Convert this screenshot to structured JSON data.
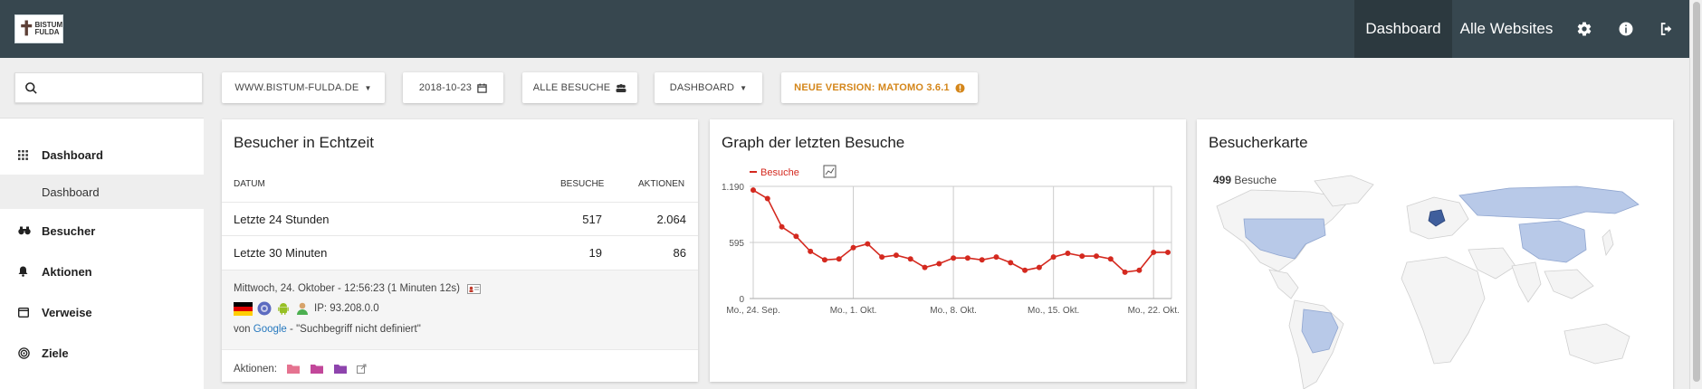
{
  "logo": {
    "line1": "BISTUM",
    "line2": "FULDA"
  },
  "nav": {
    "dashboard": "Dashboard",
    "all_websites": "Alle Websites"
  },
  "toolbar": {
    "search_placeholder": "",
    "site": "WWW.BISTUM-FULDA.DE",
    "date": "2018-10-23",
    "segment": "ALLE BESUCHE",
    "dashboard": "DASHBOARD",
    "version": "NEUE VERSION: MATOMO 3.6.1"
  },
  "sidebar": {
    "items": [
      {
        "label": "Dashboard",
        "icon": "grid-icon"
      },
      {
        "label": "Besucher",
        "icon": "binoculars-icon"
      },
      {
        "label": "Aktionen",
        "icon": "bell-icon"
      },
      {
        "label": "Verweise",
        "icon": "window-icon"
      },
      {
        "label": "Ziele",
        "icon": "target-icon"
      }
    ],
    "sub_item": "Dashboard"
  },
  "realtime": {
    "title": "Besucher in Echtzeit",
    "columns": [
      "DATUM",
      "BESUCHE",
      "AKTIONEN"
    ],
    "rows": [
      {
        "label": "Letzte 24 Stunden",
        "visits": "517",
        "actions": "2.064"
      },
      {
        "label": "Letzte 30 Minuten",
        "visits": "19",
        "actions": "86"
      }
    ],
    "visit": {
      "time": "Mittwoch, 24. Oktober - 12:56:23 (1 Minuten 12s)",
      "ip": "IP: 93.208.0.0",
      "referrer_prefix": "von",
      "referrer_link": "Google",
      "referrer_suffix": " - \"Suchbegriff nicht definiert\"",
      "actions_label": "Aktionen:"
    }
  },
  "graph": {
    "title": "Graph der letzten Besuche",
    "legend": "Besuche"
  },
  "map": {
    "title": "Besucherkarte",
    "count": "499",
    "count_label": "Besuche"
  },
  "colors": {
    "topbar": "#37474f",
    "series": "#d4291f",
    "accent": "#d4861a",
    "map_highlight": "#b8c9e8",
    "map_dark": "#3f5e9c"
  },
  "chart_data": {
    "type": "line",
    "title": "Graph der letzten Besuche",
    "series": [
      {
        "name": "Besuche",
        "values": [
          1150,
          1060,
          760,
          660,
          500,
          410,
          420,
          540,
          580,
          440,
          460,
          420,
          330,
          370,
          430,
          430,
          410,
          440,
          380,
          300,
          330,
          440,
          480,
          450,
          450,
          420,
          280,
          300,
          490,
          490
        ]
      }
    ],
    "x": [
      "2018-09-24",
      "2018-09-25",
      "2018-09-26",
      "2018-09-27",
      "2018-09-28",
      "2018-09-29",
      "2018-09-30",
      "2018-10-01",
      "2018-10-02",
      "2018-10-03",
      "2018-10-04",
      "2018-10-05",
      "2018-10-06",
      "2018-10-07",
      "2018-10-08",
      "2018-10-09",
      "2018-10-10",
      "2018-10-11",
      "2018-10-12",
      "2018-10-13",
      "2018-10-14",
      "2018-10-15",
      "2018-10-16",
      "2018-10-17",
      "2018-10-18",
      "2018-10-19",
      "2018-10-20",
      "2018-10-21",
      "2018-10-22",
      "2018-10-23"
    ],
    "x_tick_labels": [
      "Mo., 24. Sep.",
      "Mo., 1. Okt.",
      "Mo., 8. Okt.",
      "Mo., 15. Okt.",
      "Mo., 22. Okt."
    ],
    "y_tick_labels": [
      "1.190",
      "595",
      "0"
    ],
    "ylim": [
      0,
      1190
    ],
    "grid": true,
    "legend": "top-left"
  }
}
